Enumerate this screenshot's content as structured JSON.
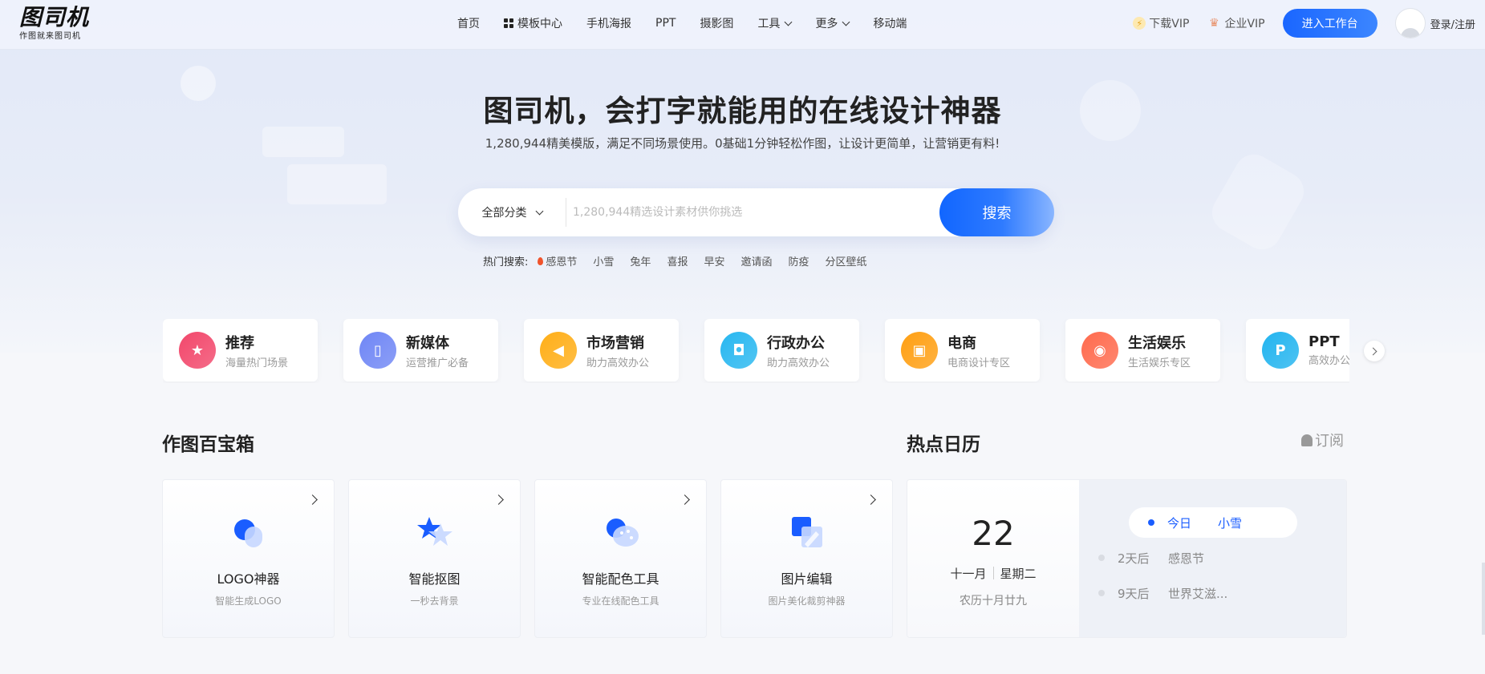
{
  "nav": {
    "logo_main": "图司机",
    "logo_sub": "作图就来图司机",
    "menu": [
      {
        "label": "首页",
        "chevron": false,
        "icon": ""
      },
      {
        "label": "模板中心",
        "chevron": false,
        "icon": "grid-icon"
      },
      {
        "label": "手机海报",
        "chevron": false,
        "icon": ""
      },
      {
        "label": "PPT",
        "chevron": false,
        "icon": ""
      },
      {
        "label": "摄影图",
        "chevron": false,
        "icon": ""
      },
      {
        "label": "工具",
        "chevron": true,
        "icon": ""
      },
      {
        "label": "更多",
        "chevron": true,
        "icon": ""
      },
      {
        "label": "移动端",
        "chevron": false,
        "icon": ""
      }
    ],
    "download_vip": "下载VIP",
    "enterprise_vip": "企业VIP",
    "workspace_button": "进入工作台",
    "login": "登录/注册"
  },
  "hero": {
    "title": "图司机，会打字就能用的在线设计神器",
    "subtitle": "1,280,944精美模版，满足不同场景使用。0基础1分钟轻松作图，让设计更简单，让营销更有料!"
  },
  "search": {
    "category": "全部分类",
    "placeholder": "1,280,944精选设计素材供你挑选",
    "button": "搜索",
    "hot_label": "热门搜索:",
    "hot_items": [
      "感恩节",
      "小雪",
      "兔年",
      "喜报",
      "早安",
      "邀请函",
      "防疫",
      "分区壁纸"
    ]
  },
  "categories": [
    {
      "title": "推荐",
      "desc": "海量热门场景",
      "color": "#f2476b",
      "icon": "shield-star-icon"
    },
    {
      "title": "新媒体",
      "desc": "运营推广必备",
      "color": "#6f86f5",
      "icon": "phone-chat-icon"
    },
    {
      "title": "市场营销",
      "desc": "助力高效办公",
      "color": "#ffae17",
      "icon": "megaphone-icon"
    },
    {
      "title": "行政办公",
      "desc": "助力高效办公",
      "color": "#27b7f0",
      "icon": "folder-user-icon"
    },
    {
      "title": "电商",
      "desc": "电商设计专区",
      "color": "#ff9f12",
      "icon": "shopping-bag-icon"
    },
    {
      "title": "生活娱乐",
      "desc": "生活娱乐专区",
      "color": "#ff6a4d",
      "icon": "gamepad-icon"
    },
    {
      "title": "PPT",
      "desc": "高效办公",
      "color": "#22b4ef",
      "icon": "ppt-file-icon"
    }
  ],
  "toolbox": {
    "title": "作图百宝箱",
    "tools": [
      {
        "name": "LOGO神器",
        "desc": "智能生成LOGO",
        "icon": "logo-maker-icon"
      },
      {
        "name": "智能抠图",
        "desc": "一秒去背景",
        "icon": "cutout-star-icon"
      },
      {
        "name": "智能配色工具",
        "desc": "专业在线配色工具",
        "icon": "palette-icon"
      },
      {
        "name": "图片编辑",
        "desc": "图片美化裁剪神器",
        "icon": "image-edit-icon"
      }
    ]
  },
  "calendar": {
    "title": "热点日历",
    "subscribe": "订阅",
    "day": "22",
    "month": "十一月",
    "weekday": "星期二",
    "lunar": "农历十月廿九",
    "events": [
      {
        "when": "今日",
        "name": "小雪"
      },
      {
        "when": "2天后",
        "name": "感恩节"
      },
      {
        "when": "9天后",
        "name": "世界艾滋..."
      }
    ]
  },
  "colors": {
    "accent": "#1a66ff"
  }
}
